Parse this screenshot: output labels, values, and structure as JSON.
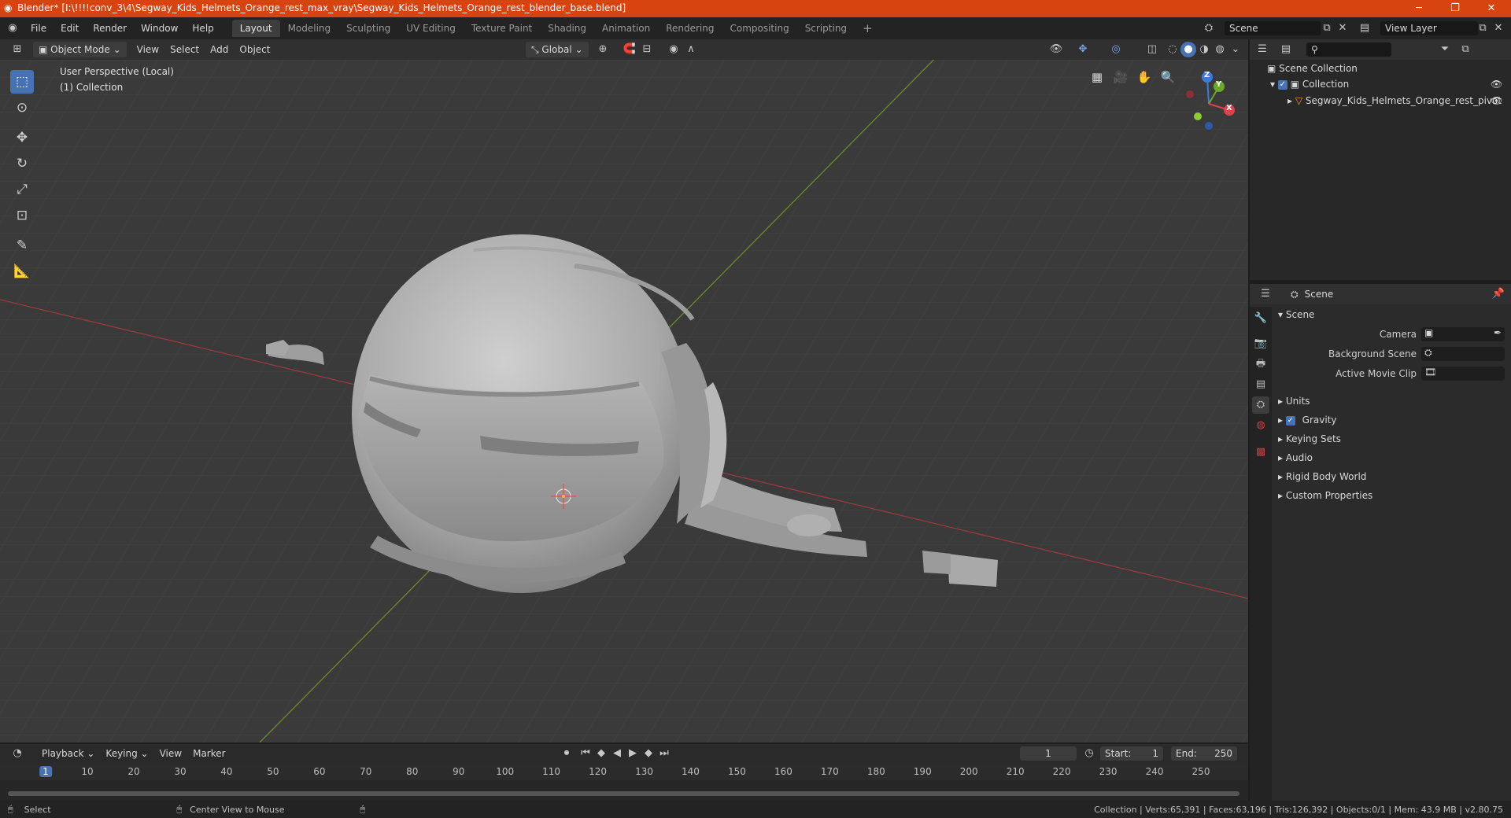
{
  "titlebar": {
    "title": "Blender* [I:\\!!!!conv_3\\4\\Segway_Kids_Helmets_Orange_rest_max_vray\\Segway_Kids_Helmets_Orange_rest_blender_base.blend]",
    "minimize": "─",
    "maximize": "❐",
    "close": "✕"
  },
  "menu": [
    "File",
    "Edit",
    "Render",
    "Window",
    "Help"
  ],
  "workspaces": [
    "Layout",
    "Modeling",
    "Sculpting",
    "UV Editing",
    "Texture Paint",
    "Shading",
    "Animation",
    "Rendering",
    "Compositing",
    "Scripting"
  ],
  "workspace_add": "+",
  "scene_field": "Scene",
  "view_layer_field": "View Layer",
  "viewport_header": {
    "mode": "Object Mode",
    "menus": [
      "View",
      "Select",
      "Add",
      "Object"
    ],
    "orientation": "Global"
  },
  "viewport": {
    "perspective_label": "User Perspective (Local)",
    "collection_label": "(1) Collection",
    "gizmo_axes": [
      "Z",
      "Y",
      "X"
    ]
  },
  "outliner": {
    "search_placeholder": "",
    "scene_collection": "Scene Collection",
    "collection": "Collection",
    "object": "Segway_Kids_Helmets_Orange_rest_pivot"
  },
  "properties": {
    "header_title": "Scene",
    "panel_title": "Scene",
    "camera_label": "Camera",
    "background_scene_label": "Background Scene",
    "active_movie_clip_label": "Active Movie Clip",
    "sections": [
      "Units",
      "Gravity",
      "Keying Sets",
      "Audio",
      "Rigid Body World",
      "Custom Properties"
    ]
  },
  "timeline": {
    "menus": [
      "Playback",
      "Keying",
      "View",
      "Marker"
    ],
    "current_frame": "1",
    "start_label": "Start:",
    "start_value": "1",
    "end_label": "End:",
    "end_value": "250",
    "ruler_marks": [
      "1",
      "10",
      "20",
      "30",
      "40",
      "50",
      "60",
      "70",
      "80",
      "90",
      "100",
      "110",
      "120",
      "130",
      "140",
      "150",
      "160",
      "170",
      "180",
      "190",
      "200",
      "210",
      "220",
      "230",
      "240",
      "250"
    ]
  },
  "statusbar": {
    "select": "Select",
    "center_view": "Center View to Mouse",
    "stats": "Collection | Verts:65,391 | Faces:63,196 | Tris:126,392 | Objects:0/1 | Mem: 43.9 MB | v2.80.75"
  }
}
